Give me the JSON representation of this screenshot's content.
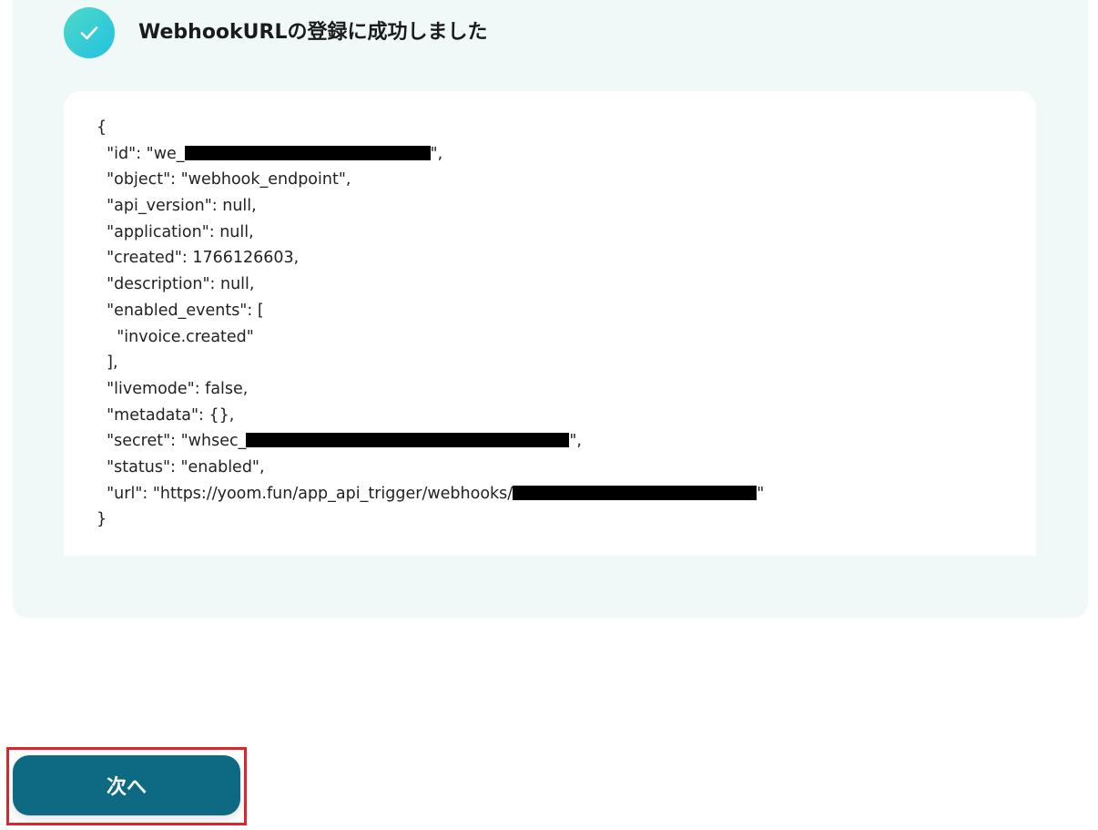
{
  "status": {
    "title": "WebhookURLの登録に成功しました",
    "icon": "check-icon",
    "accent": "#22c2e0"
  },
  "json_response": {
    "open": "{",
    "id_key": "  \"id\": \"we_",
    "id_end": "\",",
    "object": "  \"object\": \"webhook_endpoint\",",
    "api_version": "  \"api_version\": null,",
    "application": "  \"application\": null,",
    "created": "  \"created\": 1766126603,",
    "description": "  \"description\": null,",
    "enabled_events_open": "  \"enabled_events\": [",
    "event_0": "    \"invoice.created\"",
    "enabled_events_close": "  ],",
    "livemode": "  \"livemode\": false,",
    "metadata": "  \"metadata\": {},",
    "secret_key": "  \"secret\": \"whsec_",
    "secret_end": "\",",
    "status_line": "  \"status\": \"enabled\",",
    "url_key": "  \"url\": \"https://yoom.fun/app_api_trigger/webhooks/",
    "url_end": "\"",
    "close": "}"
  },
  "footer": {
    "next_label": "次へ",
    "button_color": "#0e6a82",
    "highlight_color": "#e0242c"
  }
}
